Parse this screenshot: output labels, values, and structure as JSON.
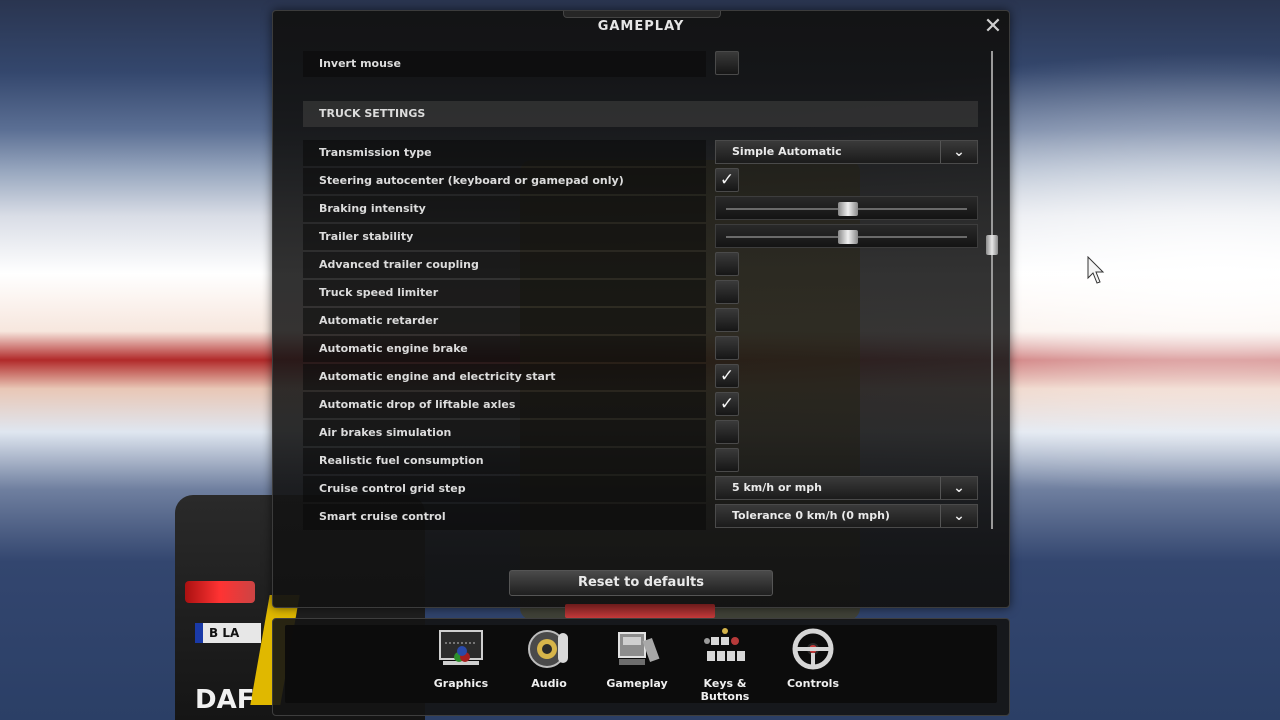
{
  "background": {
    "plate_text": "B LA",
    "brand_text": "DAF"
  },
  "panel": {
    "title": "GAMEPLAY",
    "close_label": "✕"
  },
  "rows": [
    {
      "type": "checkbox",
      "label": "Invert mouse",
      "checked": false
    },
    {
      "type": "section",
      "label": "TRUCK SETTINGS"
    },
    {
      "type": "dropdown",
      "label": "Transmission type",
      "value": "Simple Automatic"
    },
    {
      "type": "checkbox",
      "label": "Steering autocenter (keyboard or gamepad only)",
      "checked": true
    },
    {
      "type": "slider",
      "label": "Braking intensity",
      "level": 0.5
    },
    {
      "type": "slider",
      "label": "Trailer stability",
      "level": 0.5
    },
    {
      "type": "checkbox",
      "label": "Advanced trailer coupling",
      "checked": false
    },
    {
      "type": "checkbox",
      "label": "Truck speed limiter",
      "checked": false
    },
    {
      "type": "checkbox",
      "label": "Automatic retarder",
      "checked": false
    },
    {
      "type": "checkbox",
      "label": "Automatic engine brake",
      "checked": false
    },
    {
      "type": "checkbox",
      "label": "Automatic engine and electricity start",
      "checked": true
    },
    {
      "type": "checkbox",
      "label": "Automatic drop of liftable axles",
      "checked": true
    },
    {
      "type": "checkbox",
      "label": "Air brakes simulation",
      "checked": false
    },
    {
      "type": "checkbox",
      "label": "Realistic fuel consumption",
      "checked": false
    },
    {
      "type": "dropdown",
      "label": "Cruise control grid step",
      "value": "5 km/h or mph"
    },
    {
      "type": "dropdown",
      "label": "Smart cruise control",
      "value": "Tolerance 0 km/h (0 mph)"
    }
  ],
  "reset_label": "Reset to defaults",
  "toolbar": {
    "items": [
      {
        "label": "Graphics",
        "icon": "monitor-icon"
      },
      {
        "label": "Audio",
        "icon": "speaker-icon"
      },
      {
        "label": "Gameplay",
        "icon": "truck-icon"
      },
      {
        "label": "Keys & Buttons",
        "icon": "keys-icon"
      },
      {
        "label": "Controls",
        "icon": "steering-wheel-icon"
      }
    ]
  }
}
